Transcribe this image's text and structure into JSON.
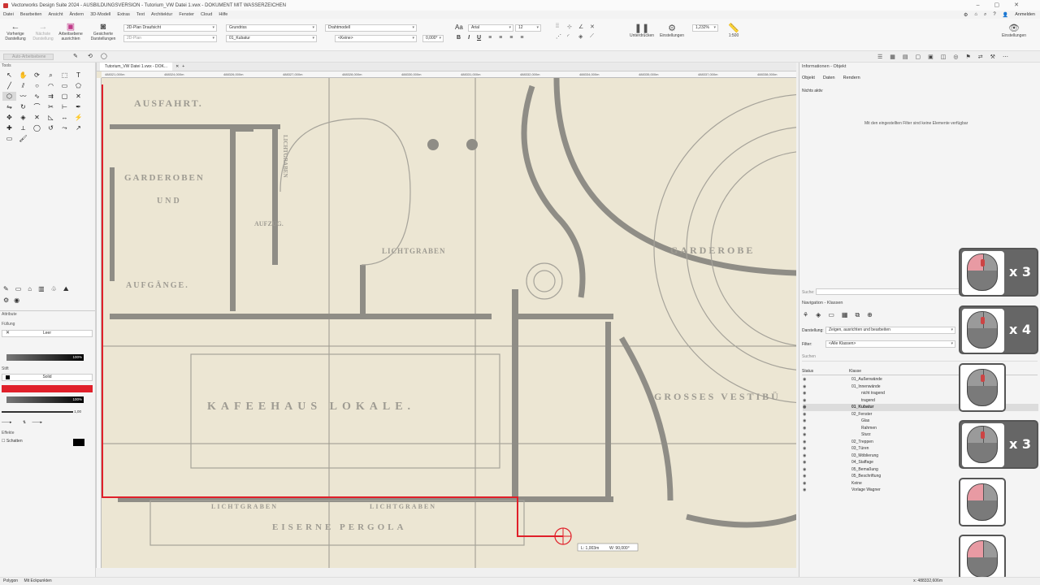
{
  "window": {
    "title": "Vectorworks Design Suite 2024 - AUSBILDUNGSVERSION - Tutorium_VW Datei 1.vwx - DOKUMENT MIT WASSERZEICHEN"
  },
  "menu": [
    "Datei",
    "Bearbeiten",
    "Ansicht",
    "Ändern",
    "3D-Modell",
    "Extras",
    "Text",
    "Architektur",
    "Fenster",
    "Cloud",
    "Hilfe"
  ],
  "menu_right": {
    "login": "Anmelden"
  },
  "toolbar": {
    "prev_view": "Vorherige Darstellung",
    "next_view": "Nächste Darstellung",
    "workplane": "Arbeitsebene ausrichten",
    "saved_views": "Gesicherte Darstellungen",
    "view_select": "2D-Plan Draufsicht",
    "view_mode": "2D-Plan",
    "projection": "Grundriss",
    "class_select": "01_Kubatur",
    "render_select": "Drahtmodell",
    "layer_select": "<Keine>",
    "angle": "0,000°",
    "font": "Arial",
    "font_size": "12",
    "snap_suppress": "Unterdrücken",
    "snap_settings": "Einstellungen",
    "zoom": "1,232%",
    "scale": "1:500",
    "settings": "Einstellungen"
  },
  "subbar": {
    "auto_layer": "Auto-Arbeitsebene"
  },
  "left_panel": {
    "tools_title": "Tools",
    "attributes_title": "Attribute",
    "fill_label": "Füllung",
    "fill_value": "Leer",
    "opacity_fill": "100%",
    "pen_label": "Stift",
    "pen_value": "Solid",
    "opacity_pen": "100%",
    "line_weight": "1,00",
    "effects_label": "Effekte",
    "shadow_label": "Schatten"
  },
  "document": {
    "tab": "Tutorium_VW Datei 1.vwx - DOK...",
    "ruler_ticks": [
      "488321,000m",
      "488324,000m",
      "488326,000m",
      "488327,000m",
      "488328,000m",
      "488330,000m",
      "488331,000m",
      "488332,000m",
      "488334,000m",
      "488335,000m",
      "488337,000m",
      "488338,000m"
    ],
    "plan_labels": {
      "ausfahrt": "AUSFAHRT.",
      "garderoben": "GARDEROBEN",
      "und": "UND",
      "aufgange": "AUFGÄNGE.",
      "aufzug": "AUFZUG.",
      "lichtgraben1": "LICHTGRABEN",
      "lichtgraben_v": "LICHTGRABEN",
      "garderobe": "GARDEROBE",
      "kafeehaus": "KAFEEHAUS LOKALE.",
      "grosses": "GROSSES VESTIBÜ",
      "lichtgraben2": "LICHTGRABEN",
      "lichtgraben3": "LICHTGRABEN",
      "eiserne": "EISERNE PERGOLA"
    },
    "dim_tooltip": {
      "length": "L: 1,003m",
      "width": "W: 90,000°"
    }
  },
  "info_panel": {
    "title": "Informationen - Objekt",
    "tabs": [
      "Objekt",
      "Daten",
      "Rendern"
    ],
    "status": "Nichts aktiv",
    "message": "Mit den eingestellten Filter sind keine Elemente verfügbar",
    "search_label": "Suche:"
  },
  "nav_panel": {
    "title": "Navigation - Klassen",
    "display_label": "Darstellung:",
    "display_value": "Zeigen, ausrichten und bearbeiten",
    "filter_label": "Filter:",
    "filter_value": "<Alle Klassen>",
    "search_placeholder": "Suchen",
    "col_status": "Status",
    "col_class": "Klasse",
    "classes": [
      {
        "label": "01_Außenwände",
        "indent": 1
      },
      {
        "label": "01_Innenwände",
        "indent": 1
      },
      {
        "label": "nicht tragend",
        "indent": 2
      },
      {
        "label": "tragend",
        "indent": 2
      },
      {
        "label": "01_Kubatur",
        "indent": 1
      },
      {
        "label": "02_Fenster",
        "indent": 1
      },
      {
        "label": "Glas",
        "indent": 2
      },
      {
        "label": "Rahmen",
        "indent": 2
      },
      {
        "label": "Sturz",
        "indent": 2
      },
      {
        "label": "02_Treppen",
        "indent": 1
      },
      {
        "label": "03_Türen",
        "indent": 1
      },
      {
        "label": "03_Möblierung",
        "indent": 1
      },
      {
        "label": "04_Staffage",
        "indent": 1
      },
      {
        "label": "05_Bemaßung",
        "indent": 1
      },
      {
        "label": "05_Beschriftung",
        "indent": 1
      },
      {
        "label": "Keine",
        "indent": 1
      },
      {
        "label": "Vorlage Wagner",
        "indent": 1
      }
    ]
  },
  "statusbar": {
    "tool": "Polygon",
    "mode": "Mit Eckpunkten",
    "coords": "x: 488332,606m"
  },
  "overlay_clicks": [
    {
      "count": "x 3"
    },
    {
      "count": "x 4"
    },
    {
      "count": ""
    },
    {
      "count": "x 3"
    },
    {
      "count": ""
    },
    {
      "count": ""
    }
  ],
  "colors": {
    "accent_red": "#e0202a",
    "paper": "#ece6d3",
    "ink": "#8a8a82"
  }
}
